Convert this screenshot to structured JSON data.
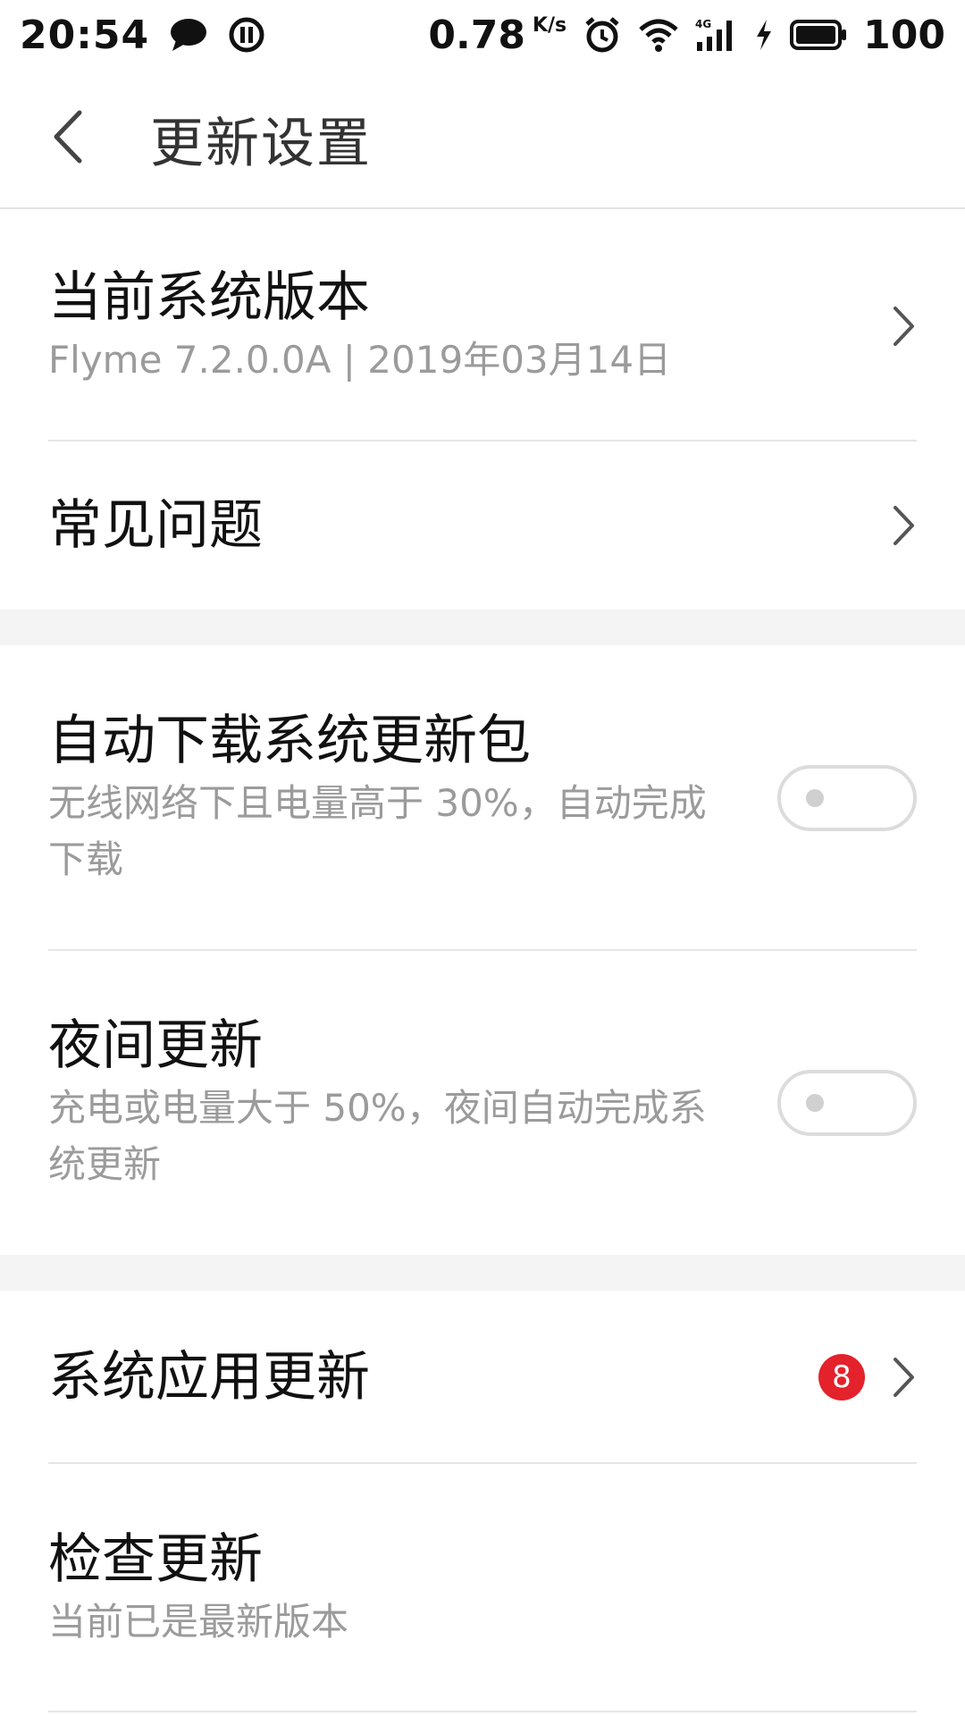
{
  "status_bar": {
    "time": "20:54",
    "net_speed": "0.78",
    "net_speed_unit": "K/s",
    "network_type": "4G",
    "battery": "100",
    "icons": [
      "chat-bubble-icon",
      "pause-circle-icon",
      "alarm-icon",
      "wifi-icon",
      "signal-icon",
      "charging-icon",
      "battery-icon"
    ]
  },
  "header": {
    "title": "更新设置",
    "back_icon": "back-arrow-icon"
  },
  "sections": {
    "version": {
      "title": "当前系统版本",
      "subtitle": "Flyme 7.2.0.0A | 2019年03月14日"
    },
    "faq": {
      "title": "常见问题"
    },
    "auto_download": {
      "title": "自动下载系统更新包",
      "subtitle": "无线网络下且电量高于 30%，自动完成下载",
      "enabled": false
    },
    "night_update": {
      "title": "夜间更新",
      "subtitle": "充电或电量大于 50%，夜间自动完成系统更新",
      "enabled": false
    },
    "app_updates": {
      "title": "系统应用更新",
      "badge": "8"
    },
    "check_update": {
      "title": "检查更新",
      "subtitle": "当前已是最新版本"
    }
  },
  "colors": {
    "badge": "#e3222b",
    "divider": "#e6e6e6",
    "section_gap": "#f4f4f4",
    "subtitle": "#9b9b9b"
  }
}
